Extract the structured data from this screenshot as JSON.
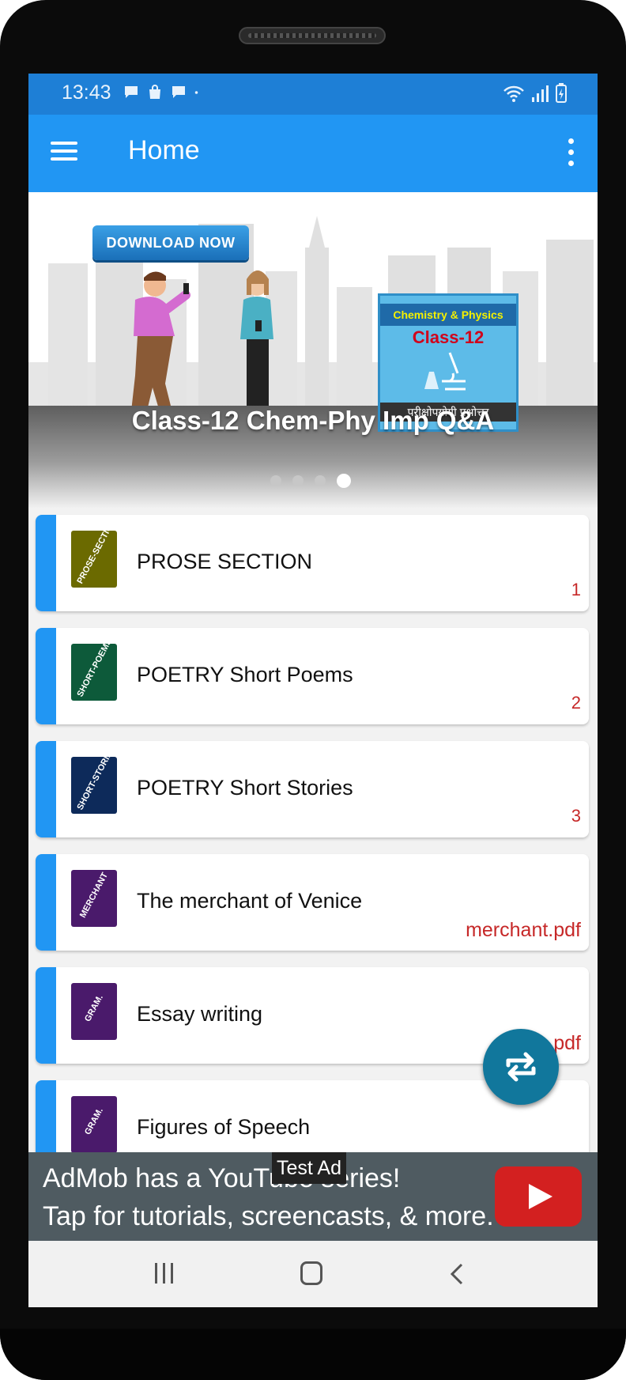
{
  "status_bar": {
    "time": "13:43"
  },
  "app_bar": {
    "title": "Home"
  },
  "banner": {
    "download_label": "DOWNLOAD NOW",
    "book_title": "Chemistry & Physics",
    "book_class": "Class-12",
    "book_footer": "परीक्षोपयोगी प्रश्नोत्तर",
    "caption": "Class-12 Chem-Phy Imp Q&A"
  },
  "list": {
    "items": [
      {
        "title": "PROSE SECTION",
        "thumb": "PROSE-SECTION",
        "thumb_color": "#6b6a00",
        "trailing": "1"
      },
      {
        "title": "POETRY Short Poems",
        "thumb": "SHORT-POEMS",
        "thumb_color": "#0d5a3a",
        "trailing": "2"
      },
      {
        "title": "POETRY Short Stories",
        "thumb": "SHORT-STORIES",
        "thumb_color": "#0d2a5a",
        "trailing": "3"
      },
      {
        "title": "The merchant of Venice",
        "thumb": "MERCHANT",
        "thumb_color": "#4a1a6b",
        "trailing": "merchant.pdf"
      },
      {
        "title": "Essay writing",
        "thumb": "GRAM.",
        "thumb_color": "#4a1a6b",
        "trailing": "pdf"
      },
      {
        "title": "Figures of Speech",
        "thumb": "GRAM.",
        "thumb_color": "#4a1a6b",
        "trailing": ""
      }
    ]
  },
  "ad": {
    "line1": "AdMob has a YouTube series!",
    "line2": "Tap for tutorials, screencasts, & more.",
    "test_label": "Test Ad"
  },
  "colors": {
    "primary": "#2196f3",
    "status_bar": "#1e7fd6",
    "accent_red": "#c62828",
    "fab": "#11779c"
  }
}
